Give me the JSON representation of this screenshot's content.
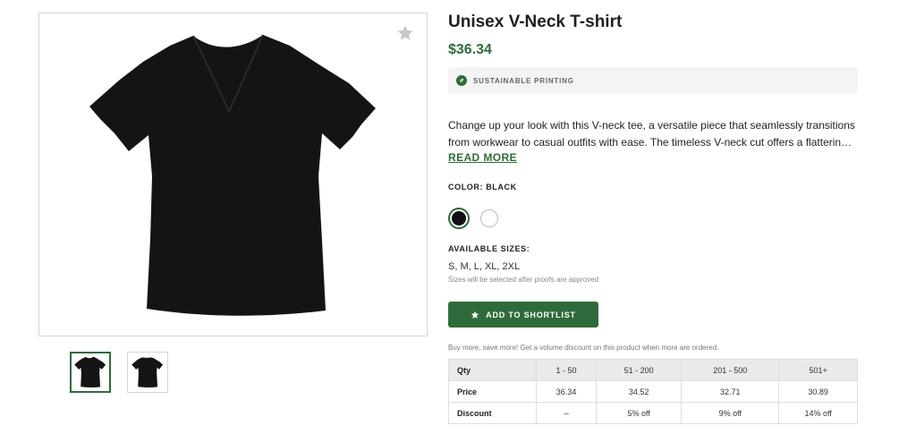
{
  "product": {
    "title": "Unisex V-Neck T-shirt",
    "price": "$36.34",
    "badge": "SUSTAINABLE PRINTING",
    "badge_icon": "leaf-icon",
    "description": "Change up your look with this V-neck tee, a versatile piece that seamlessly transitions from workwear to casual outfits with ease. The timeless V-neck cut offers a flatterin…",
    "read_more": "READ MORE"
  },
  "color": {
    "label": "COLOR: BLACK",
    "options": [
      "black",
      "white"
    ],
    "selected": "black"
  },
  "sizes": {
    "label": "AVAILABLE SIZES:",
    "value": "S, M, L, XL, 2XL",
    "note": "Sizes will be selected after proofs are approved"
  },
  "shortlist": {
    "label": "ADD TO SHORTLIST",
    "icon": "star-icon"
  },
  "volume": {
    "promo": "Buy more, save more! Get a volume discount on this product when more are ordered.",
    "header": [
      "Qty",
      "1 - 50",
      "51 - 200",
      "201 - 500",
      "501+"
    ],
    "price_row": [
      "Price",
      "36.34",
      "34.52",
      "32.71",
      "30.89"
    ],
    "discount_row": [
      "Discount",
      "--",
      "5% off",
      "9% off",
      "14% off"
    ]
  },
  "colors": {
    "accent": "#2f6b3a",
    "shirt": "#141414"
  }
}
